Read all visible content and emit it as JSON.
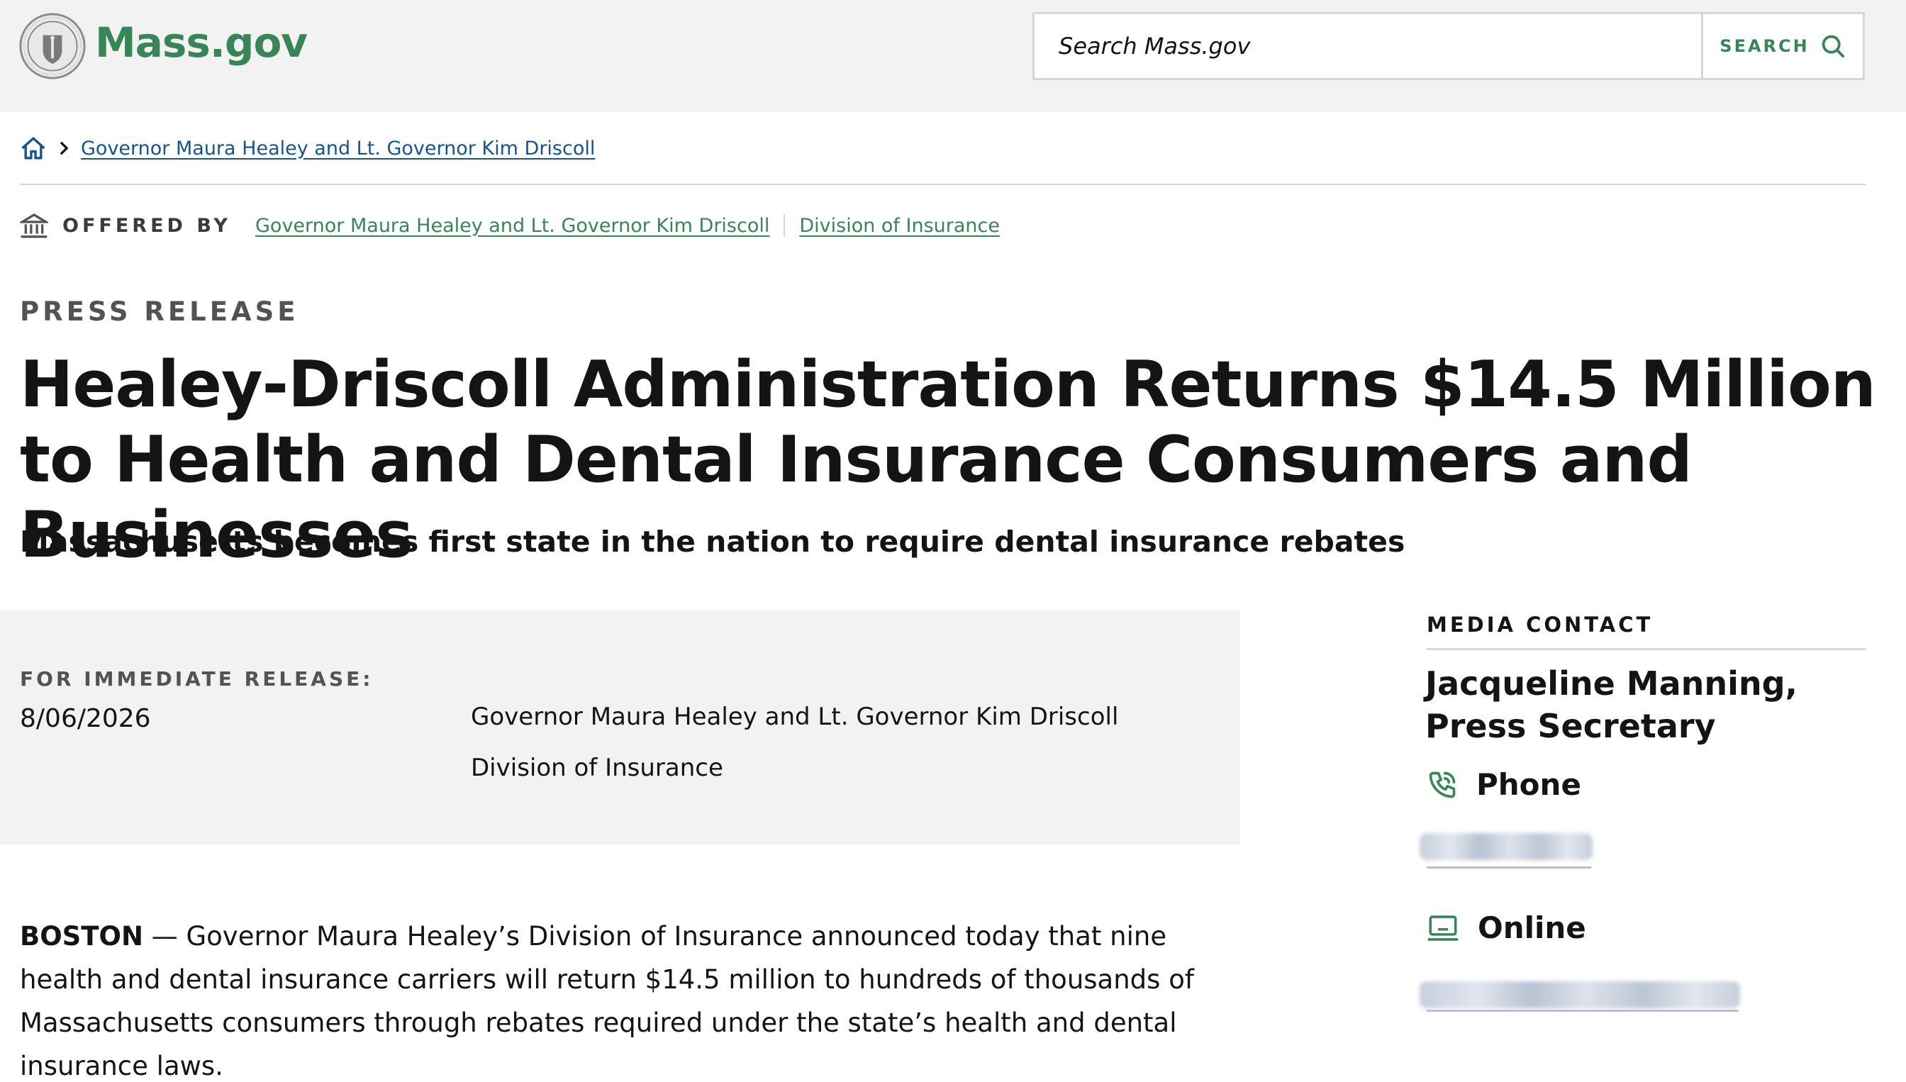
{
  "header": {
    "logo_text": "Mass.gov",
    "search_placeholder": "Search Mass.gov",
    "search_button": "SEARCH"
  },
  "breadcrumb": {
    "items": [
      "Governor Maura Healey and Lt. Governor Kim Driscoll"
    ]
  },
  "offered_by": {
    "label": "OFFERED BY",
    "links": [
      "Governor Maura Healey and Lt. Governor Kim Driscoll",
      "Division of Insurance"
    ]
  },
  "article": {
    "kicker": "PRESS RELEASE",
    "title": "Healey-Driscoll Administration Returns $14.5 Million to Health and Dental Insurance Consumers and Businesses",
    "subtitle": "Massachusetts becomes first state in the nation to require dental insurance rebates",
    "release_label": "FOR IMMEDIATE RELEASE:",
    "release_date": "8/06/2026",
    "release_orgs": [
      "Governor Maura Healey and Lt. Governor Kim Driscoll",
      "Division of Insurance"
    ],
    "dateline": "BOSTON",
    "body": "— Governor Maura Healey’s Division of Insurance announced today that nine health and dental insurance carriers will return $14.5 million to hundreds of thousands of Massachusetts consumers through rebates required under the state’s health and dental insurance laws."
  },
  "media_contact": {
    "label": "MEDIA CONTACT",
    "name": "Jacqueline Manning, Press Secretary",
    "phone_label": "Phone",
    "online_label": "Online"
  },
  "colors": {
    "brand_green": "#388557",
    "link_blue": "#14558f",
    "header_bg": "#f2f2f2"
  },
  "icons": [
    "state-seal-icon",
    "search-icon",
    "home-icon",
    "chevron-right-icon",
    "building-icon",
    "phone-icon",
    "laptop-icon"
  ]
}
